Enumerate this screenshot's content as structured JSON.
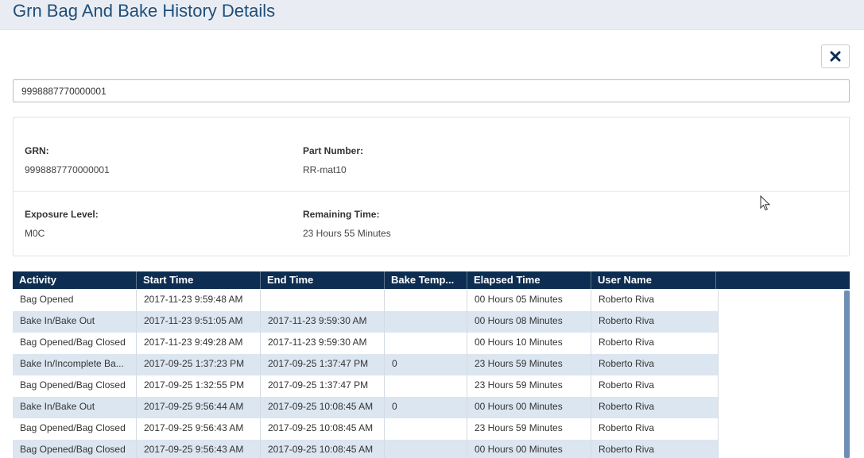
{
  "header": {
    "title": "Grn Bag And Bake History Details"
  },
  "close_button": {
    "icon": "close-icon"
  },
  "search": {
    "value": "9998887770000001"
  },
  "info": {
    "grn_label": "GRN:",
    "grn_value": "9998887770000001",
    "part_number_label": "Part Number:",
    "part_number_value": "RR-mat10",
    "exposure_label": "Exposure Level:",
    "exposure_value": "M0C",
    "remaining_label": "Remaining Time:",
    "remaining_value": "23 Hours 55 Minutes"
  },
  "table": {
    "columns": [
      "Activity",
      "Start Time",
      "End Time",
      "Bake Temp...",
      "Elapsed Time",
      "User Name"
    ],
    "rows": [
      [
        "Bag Opened",
        "2017-11-23 9:59:48 AM",
        "",
        "",
        "00 Hours 05 Minutes",
        "Roberto Riva"
      ],
      [
        "Bake In/Bake Out",
        "2017-11-23 9:51:05 AM",
        "2017-11-23 9:59:30 AM",
        "",
        "00 Hours 08 Minutes",
        "Roberto Riva"
      ],
      [
        "Bag Opened/Bag Closed",
        "2017-11-23 9:49:28 AM",
        "2017-11-23 9:59:30 AM",
        "",
        "00 Hours 10 Minutes",
        "Roberto Riva"
      ],
      [
        "Bake In/Incomplete Ba...",
        "2017-09-25 1:37:23 PM",
        "2017-09-25 1:37:47 PM",
        "0",
        "23 Hours 59 Minutes",
        "Roberto Riva"
      ],
      [
        "Bag Opened/Bag Closed",
        "2017-09-25 1:32:55 PM",
        "2017-09-25 1:37:47 PM",
        "",
        "23 Hours 59 Minutes",
        "Roberto Riva"
      ],
      [
        "Bake In/Bake Out",
        "2017-09-25 9:56:44 AM",
        "2017-09-25 10:08:45 AM",
        "0",
        "00 Hours 00 Minutes",
        "Roberto Riva"
      ],
      [
        "Bag Opened/Bag Closed",
        "2017-09-25 9:56:43 AM",
        "2017-09-25 10:08:45 AM",
        "",
        "23 Hours 59 Minutes",
        "Roberto Riva"
      ],
      [
        "Bag Opened/Bag Closed",
        "2017-09-25 9:56:43 AM",
        "2017-09-25 10:08:45 AM",
        "",
        "00 Hours 00 Minutes",
        "Roberto Riva"
      ]
    ]
  },
  "colors": {
    "header_bg": "#e9edf3",
    "title": "#1f4e79",
    "grid_header": "#0d2d52",
    "row_alt": "#dce6f1"
  }
}
